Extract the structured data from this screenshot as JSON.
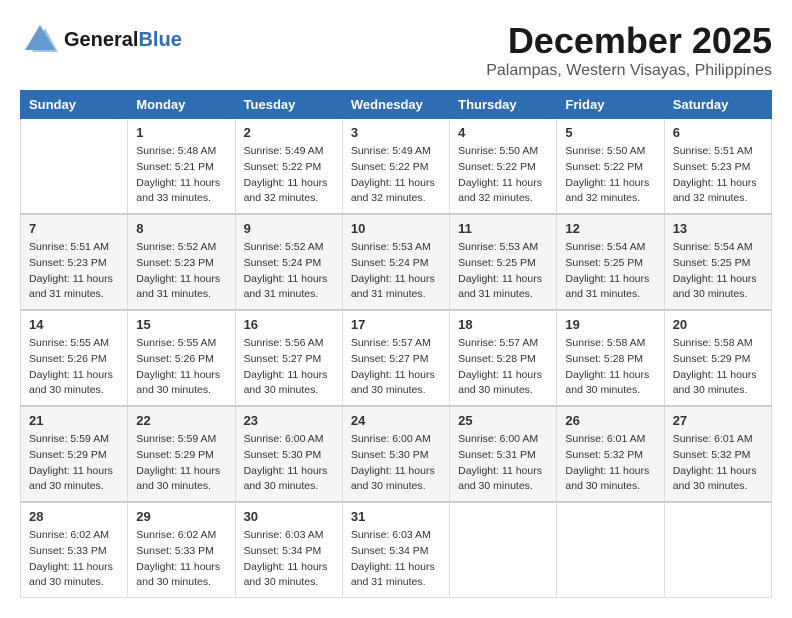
{
  "header": {
    "logo_general": "General",
    "logo_blue": "Blue",
    "month_title": "December 2025",
    "location": "Palampas, Western Visayas, Philippines"
  },
  "weekdays": [
    "Sunday",
    "Monday",
    "Tuesday",
    "Wednesday",
    "Thursday",
    "Friday",
    "Saturday"
  ],
  "weeks": [
    [
      {
        "day": "",
        "info": ""
      },
      {
        "day": "1",
        "info": "Sunrise: 5:48 AM\nSunset: 5:21 PM\nDaylight: 11 hours\nand 33 minutes."
      },
      {
        "day": "2",
        "info": "Sunrise: 5:49 AM\nSunset: 5:22 PM\nDaylight: 11 hours\nand 32 minutes."
      },
      {
        "day": "3",
        "info": "Sunrise: 5:49 AM\nSunset: 5:22 PM\nDaylight: 11 hours\nand 32 minutes."
      },
      {
        "day": "4",
        "info": "Sunrise: 5:50 AM\nSunset: 5:22 PM\nDaylight: 11 hours\nand 32 minutes."
      },
      {
        "day": "5",
        "info": "Sunrise: 5:50 AM\nSunset: 5:22 PM\nDaylight: 11 hours\nand 32 minutes."
      },
      {
        "day": "6",
        "info": "Sunrise: 5:51 AM\nSunset: 5:23 PM\nDaylight: 11 hours\nand 32 minutes."
      }
    ],
    [
      {
        "day": "7",
        "info": "Sunrise: 5:51 AM\nSunset: 5:23 PM\nDaylight: 11 hours\nand 31 minutes."
      },
      {
        "day": "8",
        "info": "Sunrise: 5:52 AM\nSunset: 5:23 PM\nDaylight: 11 hours\nand 31 minutes."
      },
      {
        "day": "9",
        "info": "Sunrise: 5:52 AM\nSunset: 5:24 PM\nDaylight: 11 hours\nand 31 minutes."
      },
      {
        "day": "10",
        "info": "Sunrise: 5:53 AM\nSunset: 5:24 PM\nDaylight: 11 hours\nand 31 minutes."
      },
      {
        "day": "11",
        "info": "Sunrise: 5:53 AM\nSunset: 5:25 PM\nDaylight: 11 hours\nand 31 minutes."
      },
      {
        "day": "12",
        "info": "Sunrise: 5:54 AM\nSunset: 5:25 PM\nDaylight: 11 hours\nand 31 minutes."
      },
      {
        "day": "13",
        "info": "Sunrise: 5:54 AM\nSunset: 5:25 PM\nDaylight: 11 hours\nand 30 minutes."
      }
    ],
    [
      {
        "day": "14",
        "info": "Sunrise: 5:55 AM\nSunset: 5:26 PM\nDaylight: 11 hours\nand 30 minutes."
      },
      {
        "day": "15",
        "info": "Sunrise: 5:55 AM\nSunset: 5:26 PM\nDaylight: 11 hours\nand 30 minutes."
      },
      {
        "day": "16",
        "info": "Sunrise: 5:56 AM\nSunset: 5:27 PM\nDaylight: 11 hours\nand 30 minutes."
      },
      {
        "day": "17",
        "info": "Sunrise: 5:57 AM\nSunset: 5:27 PM\nDaylight: 11 hours\nand 30 minutes."
      },
      {
        "day": "18",
        "info": "Sunrise: 5:57 AM\nSunset: 5:28 PM\nDaylight: 11 hours\nand 30 minutes."
      },
      {
        "day": "19",
        "info": "Sunrise: 5:58 AM\nSunset: 5:28 PM\nDaylight: 11 hours\nand 30 minutes."
      },
      {
        "day": "20",
        "info": "Sunrise: 5:58 AM\nSunset: 5:29 PM\nDaylight: 11 hours\nand 30 minutes."
      }
    ],
    [
      {
        "day": "21",
        "info": "Sunrise: 5:59 AM\nSunset: 5:29 PM\nDaylight: 11 hours\nand 30 minutes."
      },
      {
        "day": "22",
        "info": "Sunrise: 5:59 AM\nSunset: 5:29 PM\nDaylight: 11 hours\nand 30 minutes."
      },
      {
        "day": "23",
        "info": "Sunrise: 6:00 AM\nSunset: 5:30 PM\nDaylight: 11 hours\nand 30 minutes."
      },
      {
        "day": "24",
        "info": "Sunrise: 6:00 AM\nSunset: 5:30 PM\nDaylight: 11 hours\nand 30 minutes."
      },
      {
        "day": "25",
        "info": "Sunrise: 6:00 AM\nSunset: 5:31 PM\nDaylight: 11 hours\nand 30 minutes."
      },
      {
        "day": "26",
        "info": "Sunrise: 6:01 AM\nSunset: 5:32 PM\nDaylight: 11 hours\nand 30 minutes."
      },
      {
        "day": "27",
        "info": "Sunrise: 6:01 AM\nSunset: 5:32 PM\nDaylight: 11 hours\nand 30 minutes."
      }
    ],
    [
      {
        "day": "28",
        "info": "Sunrise: 6:02 AM\nSunset: 5:33 PM\nDaylight: 11 hours\nand 30 minutes."
      },
      {
        "day": "29",
        "info": "Sunrise: 6:02 AM\nSunset: 5:33 PM\nDaylight: 11 hours\nand 30 minutes."
      },
      {
        "day": "30",
        "info": "Sunrise: 6:03 AM\nSunset: 5:34 PM\nDaylight: 11 hours\nand 30 minutes."
      },
      {
        "day": "31",
        "info": "Sunrise: 6:03 AM\nSunset: 5:34 PM\nDaylight: 11 hours\nand 31 minutes."
      },
      {
        "day": "",
        "info": ""
      },
      {
        "day": "",
        "info": ""
      },
      {
        "day": "",
        "info": ""
      }
    ]
  ]
}
